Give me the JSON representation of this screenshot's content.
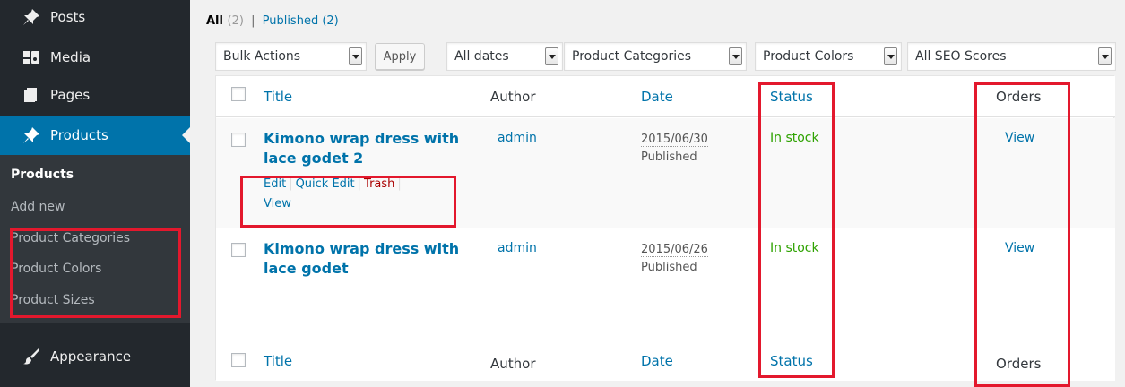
{
  "sidebar": {
    "menu": {
      "posts": "Posts",
      "media": "Media",
      "pages": "Pages",
      "products": "Products",
      "appearance": "Appearance"
    },
    "submenu": [
      "Products",
      "Add new",
      "Product Categories",
      "Product Colors",
      "Product Sizes"
    ]
  },
  "views": {
    "all_label": "All",
    "all_count": "(2)",
    "separator": "|",
    "published_label": "Published",
    "published_count": "(2)"
  },
  "filters": {
    "bulk_actions": "Bulk Actions",
    "apply": "Apply",
    "dates": "All dates",
    "categories": "Product Categories",
    "colors": "Product Colors",
    "seo": "All SEO Scores"
  },
  "table": {
    "columns": {
      "title": "Title",
      "author": "Author",
      "date": "Date",
      "status": "Status",
      "orders": "Orders"
    },
    "rows": [
      {
        "title_line1": "Kimono wrap dress with",
        "title_line2": "lace godet 2",
        "author": "admin",
        "date": "2015/06/30",
        "date_status": "Published",
        "status": "In stock",
        "orders": "View"
      },
      {
        "title_line1": "Kimono wrap dress with",
        "title_line2": "lace godet",
        "author": "admin",
        "date": "2015/06/26",
        "date_status": "Published",
        "status": "In stock",
        "orders": "View"
      }
    ],
    "row_actions": {
      "edit": "Edit",
      "quick_edit": "Quick Edit",
      "trash": "Trash",
      "view": "View",
      "separator": "|"
    }
  },
  "colors": {
    "sidebar_bg": "#23282d",
    "submenu_bg": "#32373c",
    "accent": "#0073aa",
    "in_stock": "#2ea200",
    "trash": "#a00",
    "highlight": "#e3182d"
  }
}
